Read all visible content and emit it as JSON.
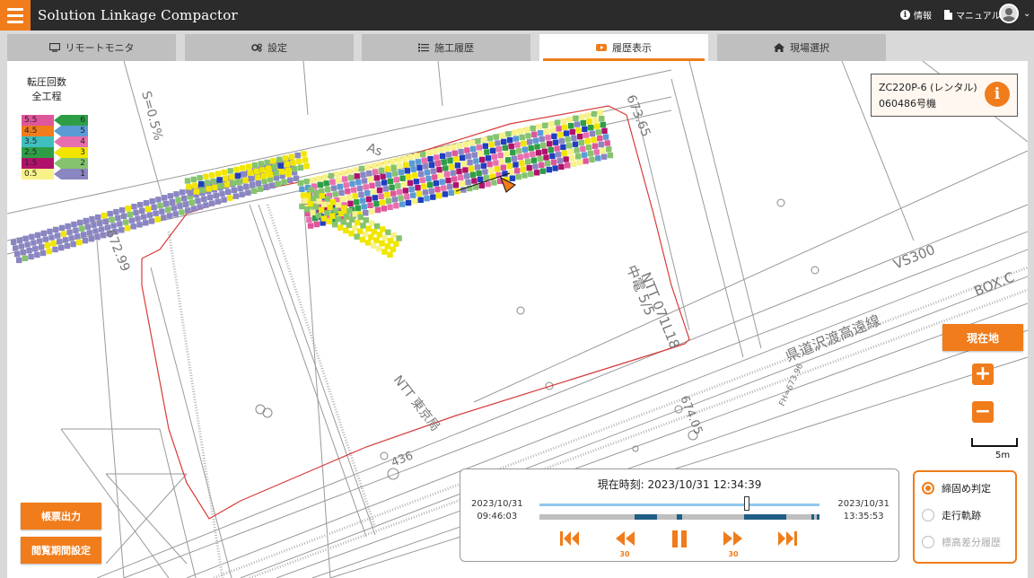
{
  "header": {
    "app_title": "Solution Linkage Compactor",
    "info_label": "情報",
    "manual_label": "マニュアル"
  },
  "tabs": [
    {
      "label": "リモートモニタ",
      "icon": "monitor-icon",
      "active": false
    },
    {
      "label": "設定",
      "icon": "gears-icon",
      "active": false
    },
    {
      "label": "施工履歴",
      "icon": "list-icon",
      "active": false
    },
    {
      "label": "履歴表示",
      "icon": "video-play-icon",
      "active": true
    },
    {
      "label": "現場選択",
      "icon": "home-icon",
      "active": false
    }
  ],
  "legend": {
    "title_line1": "転圧回数",
    "title_line2": "全工程",
    "rows": [
      {
        "left": "5.5",
        "right": "6",
        "left_color": "#e0569b",
        "right_color": "#2e9e46"
      },
      {
        "left": "4.5",
        "right": "5",
        "left_color": "#f07c1b",
        "right_color": "#5b9bd5"
      },
      {
        "left": "3.5",
        "right": "4",
        "left_color": "#3fbfbf",
        "right_color": "#e86fae"
      },
      {
        "left": "2.5",
        "right": "3",
        "left_color": "#2e9e46",
        "right_color": "#f2e600"
      },
      {
        "left": "1.5",
        "right": "2",
        "left_color": "#b0126b",
        "right_color": "#86c36e"
      },
      {
        "left": "0.5",
        "right": "1",
        "left_color": "#f7f28a",
        "right_color": "#8a86c2"
      }
    ]
  },
  "machine": {
    "model": "ZC220P-6 (レンタル)",
    "unit": "060486号機"
  },
  "map_labels": {
    "s_label": "S=0.5%",
    "as_label": "As",
    "v1": "673.65",
    "v2": "672.99",
    "vs": "VS300",
    "box": "BOX.C",
    "road": "県道沢渡高遠線",
    "ntt": "NTT 東京局",
    "v3": "674.05",
    "v4": "436",
    "fh": "FH=673.96",
    "pole": "中電 5/5",
    "pole2": "NTT 071L18"
  },
  "controls": {
    "current_location": "現在地",
    "zoom_in": "+",
    "zoom_out": "−",
    "scale": "5m",
    "report_output": "帳票出力",
    "period_setting": "閲覧期間設定"
  },
  "playback": {
    "current_time_label": "現在時刻: 2023/10/31 12:34:39",
    "start_date": "2023/10/31",
    "start_time": "09:46:03",
    "end_date": "2023/10/31",
    "end_time": "13:35:53",
    "position": 0.74,
    "rewind_speed": "30",
    "forward_speed": "30",
    "segments": [
      [
        0.34,
        0.36
      ],
      [
        0.35,
        0.42
      ],
      [
        0.49,
        0.51
      ],
      [
        0.73,
        0.88
      ],
      [
        0.97,
        0.98
      ],
      [
        0.99,
        1.0
      ]
    ]
  },
  "modes": [
    {
      "label": "締固め判定",
      "checked": true,
      "disabled": false
    },
    {
      "label": "走行軌跡",
      "checked": false,
      "disabled": false
    },
    {
      "label": "標高差分履歴",
      "checked": false,
      "disabled": true
    }
  ],
  "colors": {
    "accent": "#f07c1b",
    "header_bg": "#2b2b2b",
    "timeline_fill": "#1f5f85",
    "slider_track": "#8fc8ee"
  }
}
